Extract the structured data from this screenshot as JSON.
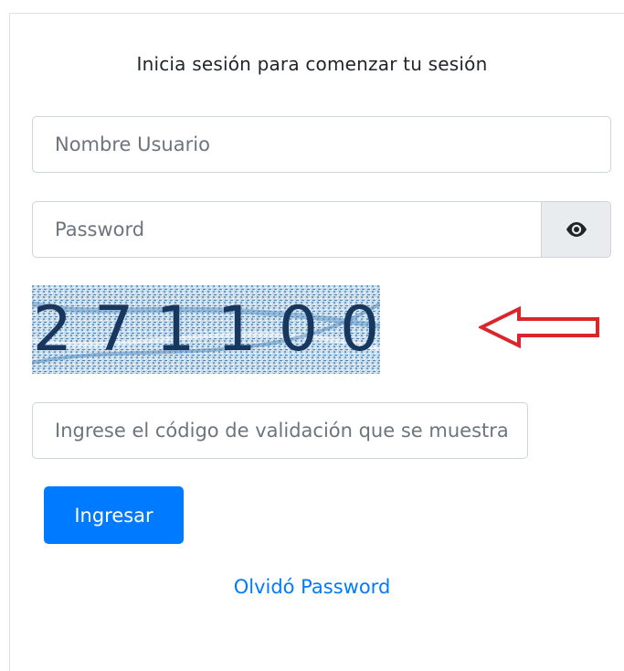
{
  "login": {
    "title": "Inicia sesión para comenzar tu sesión",
    "username_placeholder": "Nombre Usuario",
    "password_placeholder": "Password",
    "captcha_code": "271100",
    "captcha_placeholder": "Ingrese el código de validación que se muestra",
    "submit_label": "Ingresar",
    "forgot_label": "Olvidó Password"
  },
  "colors": {
    "primary": "#007bff",
    "arrow": "#d9262c",
    "captcha_text": "#17375e",
    "captcha_noise": "#6f9ec7"
  },
  "icons": {
    "password_toggle": "eye-icon",
    "annotation": "arrow-left-icon"
  }
}
